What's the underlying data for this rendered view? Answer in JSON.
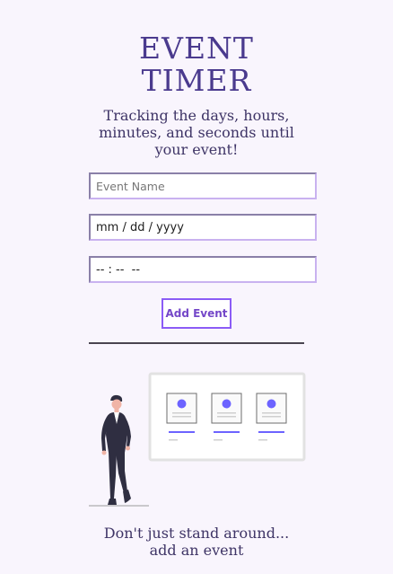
{
  "header": {
    "title_line1": "EVENT",
    "title_line2": "TIMER",
    "subtitle": "Tracking the days, hours, minutes, and seconds until your event!"
  },
  "form": {
    "event_name_placeholder": "Event Name",
    "date_placeholder": "mm / dd / yyyy",
    "time_placeholder": "-- : --  --",
    "add_button_label": "Add Event"
  },
  "footer": {
    "line1": "Don't just stand around...",
    "line2": "add an event"
  },
  "colors": {
    "background": "#f9f5fd",
    "title": "#4a3a8e",
    "accent": "#8b5cf6",
    "avatar_dot": "#6c63ff"
  }
}
